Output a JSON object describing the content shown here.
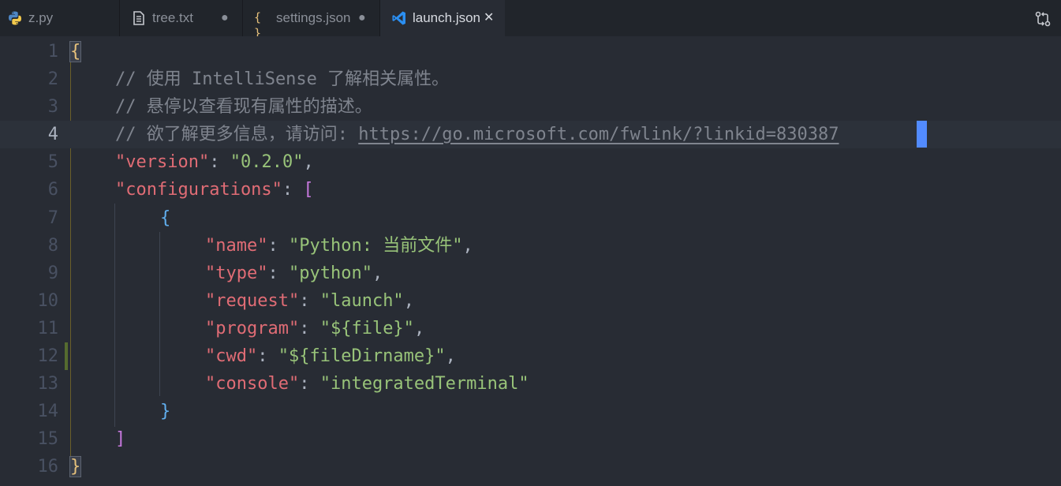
{
  "tabs": [
    {
      "label": "z.py",
      "icon": "python-icon",
      "status": ""
    },
    {
      "label": "tree.txt",
      "icon": "text-file-icon",
      "status": "●"
    },
    {
      "label": "settings.json",
      "icon": "json-braces-icon",
      "status": "●"
    },
    {
      "label": "launch.json",
      "icon": "vscode-icon",
      "status": "✕",
      "active": true
    }
  ],
  "toolbar": {
    "compare_icon": "compare-changes-icon"
  },
  "editor": {
    "line_numbers": [
      "1",
      "2",
      "3",
      "4",
      "5",
      "6",
      "7",
      "8",
      "9",
      "10",
      "11",
      "12",
      "13",
      "14",
      "15",
      "16"
    ],
    "current_line": 4,
    "lines": {
      "l1_open": "{",
      "l2_comment": "// 使用 IntelliSense 了解相关属性。",
      "l3_comment": "// 悬停以查看现有属性的描述。",
      "l4_comment": "// 欲了解更多信息，请访问: ",
      "l4_link": "https://go.microsoft.com/fwlink/?linkid=830387",
      "l5_key": "\"version\"",
      "l5_val": "\"0.2.0\"",
      "l6_key": "\"configurations\"",
      "l6_bracket": "[",
      "l7_open": "{",
      "l8_key": "\"name\"",
      "l8_val": "\"Python: 当前文件\"",
      "l9_key": "\"type\"",
      "l9_val": "\"python\"",
      "l10_key": "\"request\"",
      "l10_val": "\"launch\"",
      "l11_key": "\"program\"",
      "l11_val": "\"${file}\"",
      "l12_key": "\"cwd\"",
      "l12_val": "\"${fileDirname}\"",
      "l13_key": "\"console\"",
      "l13_val": "\"integratedTerminal\"",
      "l14_close": "}",
      "l15_bracket": "]",
      "l16_close": "}"
    },
    "punct": {
      "colon": ": ",
      "comma": ","
    }
  },
  "colors": {
    "background": "#282c34",
    "key": "#e06c75",
    "string": "#98c379",
    "comment": "#7f848e",
    "bracket_gold": "#e5c07b",
    "bracket_magenta": "#c678dd",
    "bracket_blue": "#61afef",
    "cursor": "#528bff"
  }
}
